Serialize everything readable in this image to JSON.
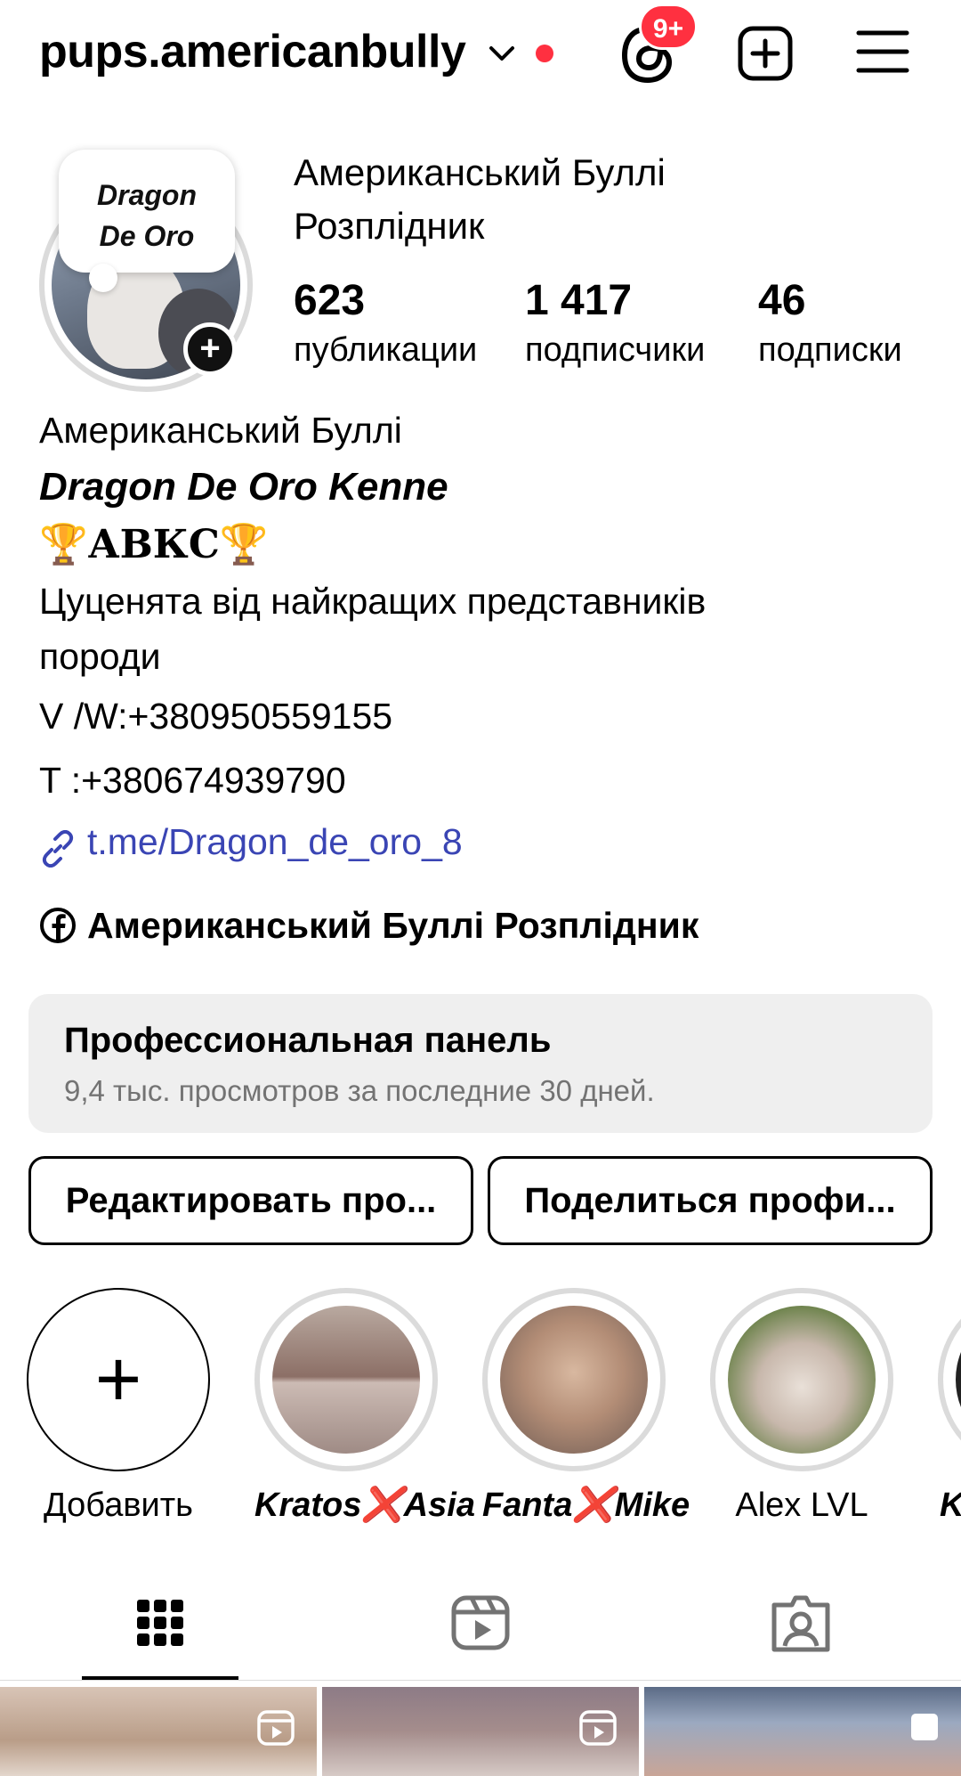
{
  "header": {
    "username": "pups.americanbully",
    "notif_badge": "9+"
  },
  "profile": {
    "note_line1": "Dragon",
    "note_line2": "De Oro",
    "display_name_line1": "Американський Буллі",
    "display_name_line2": "Розплідник",
    "stats": [
      {
        "value": "623",
        "label": "публикации"
      },
      {
        "value": "1 417",
        "label": "подписчики"
      },
      {
        "value": "46",
        "label": "подписки"
      }
    ]
  },
  "bio": {
    "line1": "Американський Буллі",
    "line2": "Dragon De Oro Kenne",
    "line3": "🏆АВКС🏆",
    "line4": "Цуценята від найкращих представників",
    "line5": "породи",
    "line6": " V /W:+380950559155",
    "line7": " T :+380674939790",
    "link": "t.me/Dragon_de_oro_8",
    "facebook": "Американський Буллі Розплідник"
  },
  "pro_panel": {
    "title": "Профессиональная панель",
    "subtitle": "9,4 тыс. просмотров за последние 30 дней."
  },
  "buttons": {
    "edit": "Редактировать про...",
    "share": "Поделиться профи..."
  },
  "highlights": [
    {
      "label": "Добавить"
    },
    {
      "label": "Kratos❌Asia"
    },
    {
      "label": "Fanta❌Mike"
    },
    {
      "label": "Alex LVL"
    },
    {
      "label": "Kra"
    }
  ],
  "colors": {
    "accent_red": "#ff3040",
    "link_blue": "#3a45b4",
    "panel_bg": "#efefef",
    "muted_text": "#737373"
  },
  "icons": {
    "header": [
      "chevron-down-icon",
      "threads-icon",
      "add-post-icon",
      "menu-icon"
    ],
    "tabs": [
      "grid-icon",
      "reels-icon",
      "tagged-icon"
    ]
  }
}
